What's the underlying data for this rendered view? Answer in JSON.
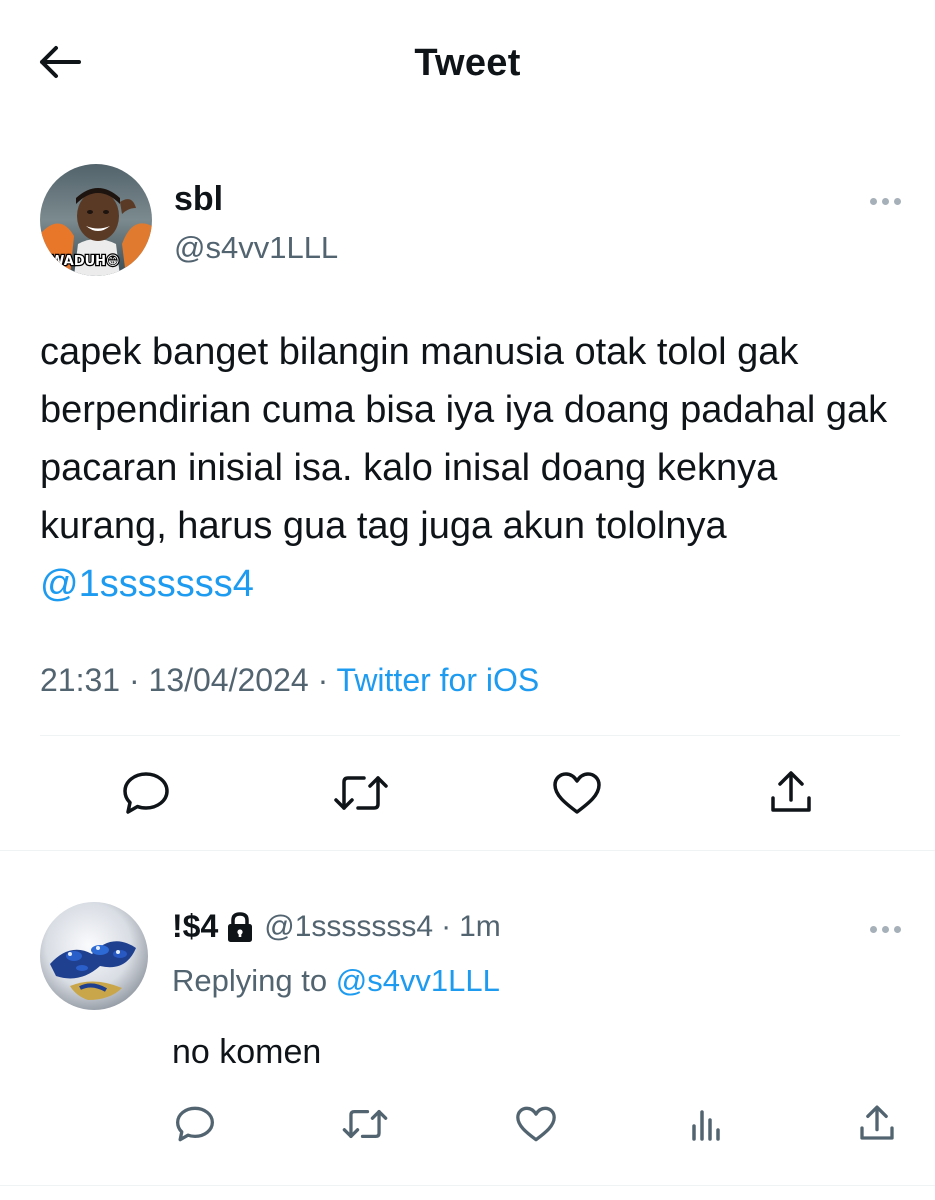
{
  "header": {
    "title": "Tweet"
  },
  "tweet": {
    "author_name": "sbl",
    "author_handle": "@s4vv1LLL",
    "avatar_caption": "WADUH😁",
    "text": "capek banget bilangin manusia otak tolol gak berpendirian cuma bisa iya iya doang padahal gak pacaran inisial isa. kalo inisal doang keknya kurang, harus gua tag juga akun tololnya ",
    "mention": "@1sssssss4",
    "time": "21:31",
    "date": "13/04/2024",
    "separator": "·",
    "source": "Twitter for iOS"
  },
  "reply": {
    "author_name": "!$4",
    "author_handle": "@1sssssss4",
    "time_ago": "1m",
    "separator": "·",
    "replying_prefix": "Replying to ",
    "replying_to": "@s4vv1LLL",
    "text": "no komen"
  },
  "icons": {
    "back": "arrow-left-icon",
    "more": "more-horizontal-icon",
    "reply": "reply-bubble-icon",
    "retweet": "retweet-icon",
    "like": "heart-icon",
    "share": "share-icon",
    "views": "analytics-icon",
    "lock": "lock-icon"
  },
  "colors": {
    "text": "#0f1419",
    "secondary": "#536471",
    "accent": "#1d9bf0",
    "divider": "#eff3f4"
  }
}
